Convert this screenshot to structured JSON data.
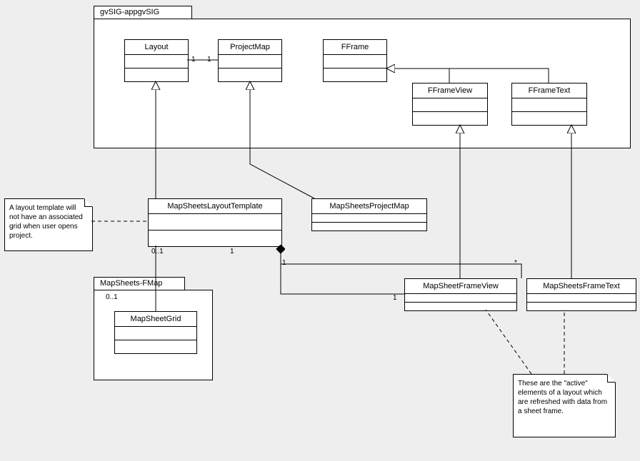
{
  "packages": {
    "outer": {
      "name_bind": "gvSIG-appgvSIG"
    },
    "inner": {
      "name_bind": "MapSheets-FMap"
    }
  },
  "classes": {
    "layout": "Layout",
    "projectmap": "ProjectMap",
    "fframe": "FFrame",
    "fframeview": "FFrameView",
    "fframetext": "FFrameText",
    "mapsheetslayouttemplate": "MapSheetsLayoutTemplate",
    "mapsheetsprojectmap": "MapSheetsProjectMap",
    "mapsheetframeview": "MapSheetFrameView",
    "mapsheetsframetext": "MapSheetsFrameText",
    "mapsheetgrid": "MapSheetGrid"
  },
  "notes": {
    "note1": "A layout template will not have an associated grid when user opens project.",
    "note2": "These are the \"active\" elements of a layout which are refreshed with data from a sheet frame."
  },
  "multiplicities": {
    "m1a": "1",
    "m1b": "1",
    "m2a": "0..1",
    "m2b": "0..1",
    "m3a": "1",
    "m3b": "1",
    "m3c": "1",
    "m4": "*"
  },
  "meta": {
    "diagram_type": "UML Class Diagram"
  }
}
